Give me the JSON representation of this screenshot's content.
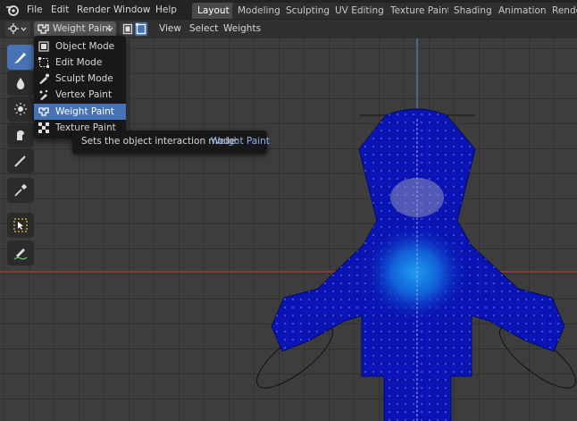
{
  "menu": [
    "File",
    "Edit",
    "Render",
    "Window",
    "Help"
  ],
  "workspace_tabs": [
    {
      "label": "Layout",
      "active": true
    },
    {
      "label": "Modeling",
      "active": false
    },
    {
      "label": "Sculpting",
      "active": false
    },
    {
      "label": "UV Editing",
      "active": false
    },
    {
      "label": "Texture Paint",
      "active": false
    },
    {
      "label": "Shading",
      "active": false
    },
    {
      "label": "Animation",
      "active": false
    },
    {
      "label": "Render",
      "active": false
    }
  ],
  "header": {
    "mode_label": "Weight Paint",
    "view_label": "View",
    "select_label": "Select",
    "weights_label": "Weights"
  },
  "mode_menu": {
    "items": [
      {
        "label": "Object Mode",
        "icon": "object-mode-icon",
        "selected": false
      },
      {
        "label": "Edit Mode",
        "icon": "edit-mode-icon",
        "selected": false
      },
      {
        "label": "Sculpt Mode",
        "icon": "sculpt-mode-icon",
        "selected": false
      },
      {
        "label": "Vertex Paint",
        "icon": "vertex-paint-icon",
        "selected": false
      },
      {
        "label": "Weight Paint",
        "icon": "weight-paint-icon",
        "selected": true
      },
      {
        "label": "Texture Paint",
        "icon": "texture-paint-icon",
        "selected": false
      }
    ]
  },
  "tooltip": {
    "text": "Sets the object interaction mode:",
    "value": "Weight Paint"
  },
  "toolbar": [
    {
      "icon": "brush-icon",
      "active": true
    },
    {
      "icon": "blur-drop-icon",
      "active": false
    },
    {
      "icon": "average-icon",
      "active": false
    },
    {
      "icon": "smear-icon",
      "active": false
    },
    {
      "icon": "gradient-icon",
      "active": false
    },
    {
      "icon": "sample-weight-icon",
      "active": false
    },
    {
      "icon": "select-box-icon",
      "active": false
    },
    {
      "icon": "annotate-icon",
      "active": false
    }
  ],
  "colors": {
    "accent": "#4772b3",
    "mesh_blue": "#0a14b4",
    "axis_x": "#b03a3a",
    "axis_y": "#4f7fbf"
  }
}
